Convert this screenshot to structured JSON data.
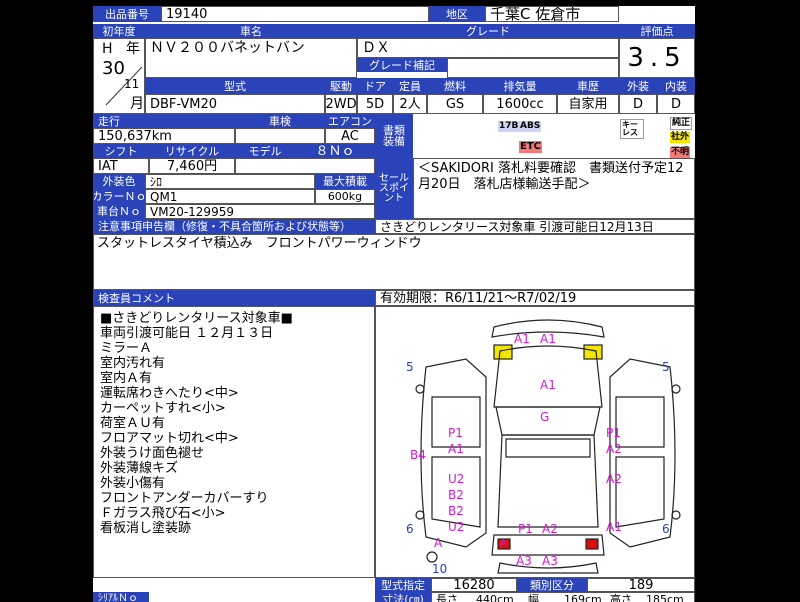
{
  "header": {
    "lot_label": "出品番号",
    "lot_value": "19140",
    "region_label": "地区",
    "region_value": "千葉C 佐倉市",
    "score_label": "評価点",
    "score_value": "3.5"
  },
  "row_year": {
    "year_label": "初年度",
    "name_label": "車名",
    "grade_label": "グレード",
    "era": "H",
    "year_unit": "年",
    "year_value": "30",
    "month_value": "11",
    "month_unit": "月",
    "car_name": "ＮＶ２００バネットバン",
    "grade_value": "ＤＸ",
    "grade_note_label": "グレード補記"
  },
  "spec_headers": {
    "model": "型式",
    "drive": "駆動",
    "doors": "ドア",
    "seats": "定員",
    "fuel": "燃料",
    "displacement": "排気量",
    "history": "車歴",
    "exterior": "外装",
    "interior": "内装"
  },
  "spec_values": {
    "model": "DBF-VM20",
    "drive": "2WD",
    "doors": "5D",
    "seats": "2人",
    "fuel": "GS",
    "displacement": "1600cc",
    "history": "自家用",
    "exterior": "D",
    "interior": "D"
  },
  "mileage": {
    "mileage_label": "走行",
    "inspection_label": "車検",
    "ac_label": "エアコン",
    "docs_label": "書類装備",
    "mileage_value": "150,637km",
    "ac_value": "AC"
  },
  "equipment_badges": [
    "17B",
    "ABS",
    "ETC",
    "キーレス"
  ],
  "doc_badges": [
    "純正",
    "社外",
    "不明"
  ],
  "shift": {
    "shift_label": "シフト",
    "recycle_label": "リサイクル",
    "model_label": "モデル",
    "shift_value": "IAT",
    "recycle_value": "7,460円",
    "model_value": "８Ｎｏ"
  },
  "color": {
    "color_label": "外装色",
    "color_value": "ｼﾛ",
    "color_no_label": "カラーＮｏ",
    "color_no_value": "QM1",
    "max_load_label": "最大積載",
    "max_load_value": "600kg",
    "chassis_label": "車台Ｎｏ",
    "chassis_value": "VM20-129959",
    "sales_point_label": "セールスポイント",
    "sales_point_text": "＜SAKIDORI 落札料要確認　書類送付予定12月20日　落札店様輸送手配＞"
  },
  "notes": {
    "caution_label": "注意事項申告欄（修復・不具合箇所および状態等）",
    "caution_right": "さきどりレンタリース対象車 引渡可能日12月13日",
    "caution_text": "スタットレスタイヤ積込み　フロントパワーウィンドウ"
  },
  "inspector": {
    "label": "検査員コメント",
    "lines": [
      "■さきどりレンタリース対象車■",
      "車両引渡可能日 １２月１３日",
      "ミラーＡ",
      "室内汚れ有",
      "室内Ａ有",
      "運転席わきへたり<中>",
      "カーペットすれ<小>",
      "荷室ＡＵ有",
      "フロアマット切れ<中>",
      "外装うけ面色褪せ",
      "外装薄線キズ",
      "外装小傷有",
      "フロントアンダーカバーすり",
      "Ｆガラス飛び石<小>",
      "看板消し塗装跡"
    ]
  },
  "diagram": {
    "validity": "有効期限：R6/11/21～R7/02/19",
    "marks": [
      "A1",
      "A1",
      "5",
      "5",
      "A1",
      "G",
      "P1",
      "P1",
      "A1",
      "A2",
      "B4",
      "U2",
      "A2",
      "B2",
      "B2",
      "6",
      "6",
      "U2",
      "A1",
      "A",
      "P1",
      "A2",
      "A1",
      "A",
      "A3",
      "A3",
      "10"
    ]
  },
  "footer": {
    "type_label": "型式指定",
    "type_value": "16280",
    "class_label": "類別区分",
    "class_value": "189",
    "dims_label": "寸法(㎝)",
    "length_label": "長さ",
    "length_value": "440cm",
    "width_label": "幅",
    "width_value": "169cm",
    "height_label": "高さ",
    "height_value": "185cm",
    "left_label": "ｼﾘｱﾙＮｏ"
  },
  "colors": {
    "label_blue": "#2b43b8",
    "mark_magenta": "#d01ad0",
    "yellow": "#f2e600",
    "red": "#d81010"
  }
}
